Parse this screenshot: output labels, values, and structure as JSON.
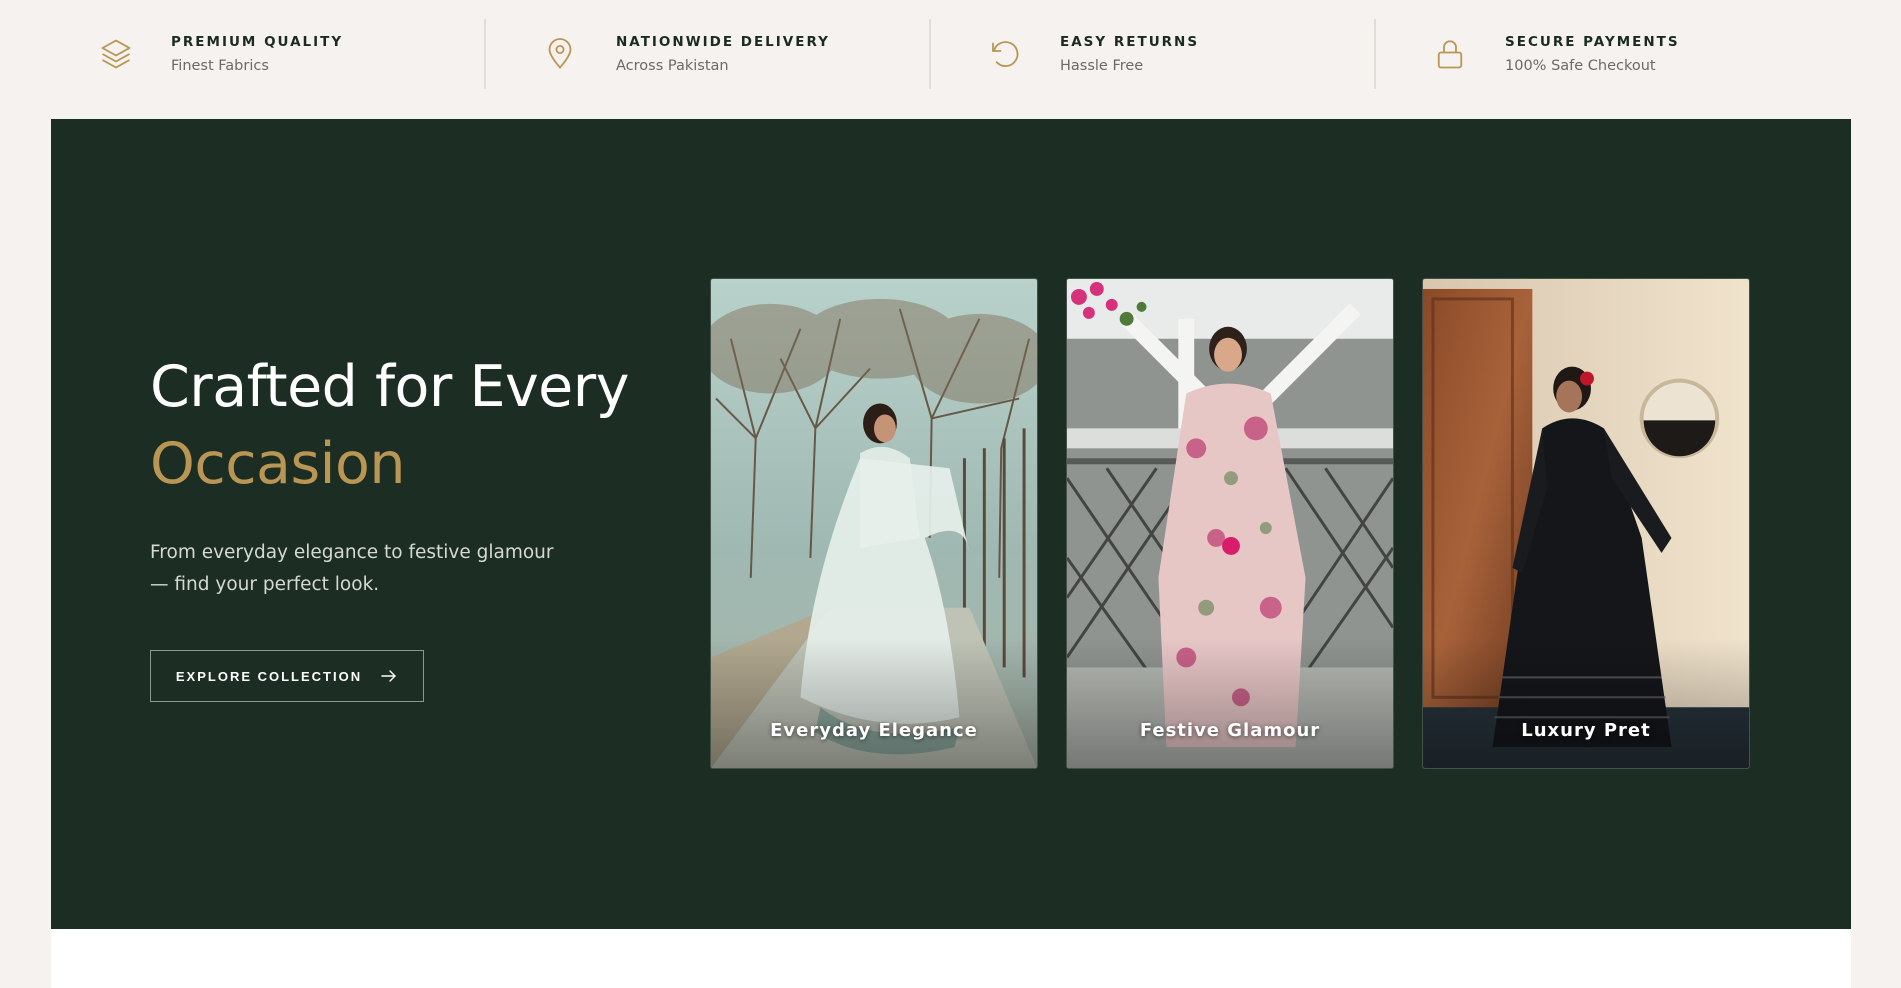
{
  "features": [
    {
      "title": "PREMIUM QUALITY",
      "subtitle": "Finest Fabrics",
      "icon": "layers-icon"
    },
    {
      "title": "NATIONWIDE DELIVERY",
      "subtitle": "Across Pakistan",
      "icon": "map-pin-icon"
    },
    {
      "title": "EASY RETURNS",
      "subtitle": "Hassle Free",
      "icon": "rotate-ccw-icon"
    },
    {
      "title": "SECURE PAYMENTS",
      "subtitle": "100% Safe Checkout",
      "icon": "lock-icon"
    }
  ],
  "hero": {
    "headline_line1": "Crafted for Every",
    "headline_line2": "Occasion",
    "lead": "From everyday elegance to festive glamour — find your perfect look.",
    "cta_label": "EXPLORE COLLECTION",
    "cta_icon": "arrow-right-icon"
  },
  "collections": [
    {
      "label": "Everyday Elegance"
    },
    {
      "label": "Festive Glamour"
    },
    {
      "label": "Luxury Pret"
    }
  ],
  "colors": {
    "hero_bg": "#1c2d23",
    "accent_gold": "#b99653",
    "page_bg": "#f5f2ef"
  }
}
